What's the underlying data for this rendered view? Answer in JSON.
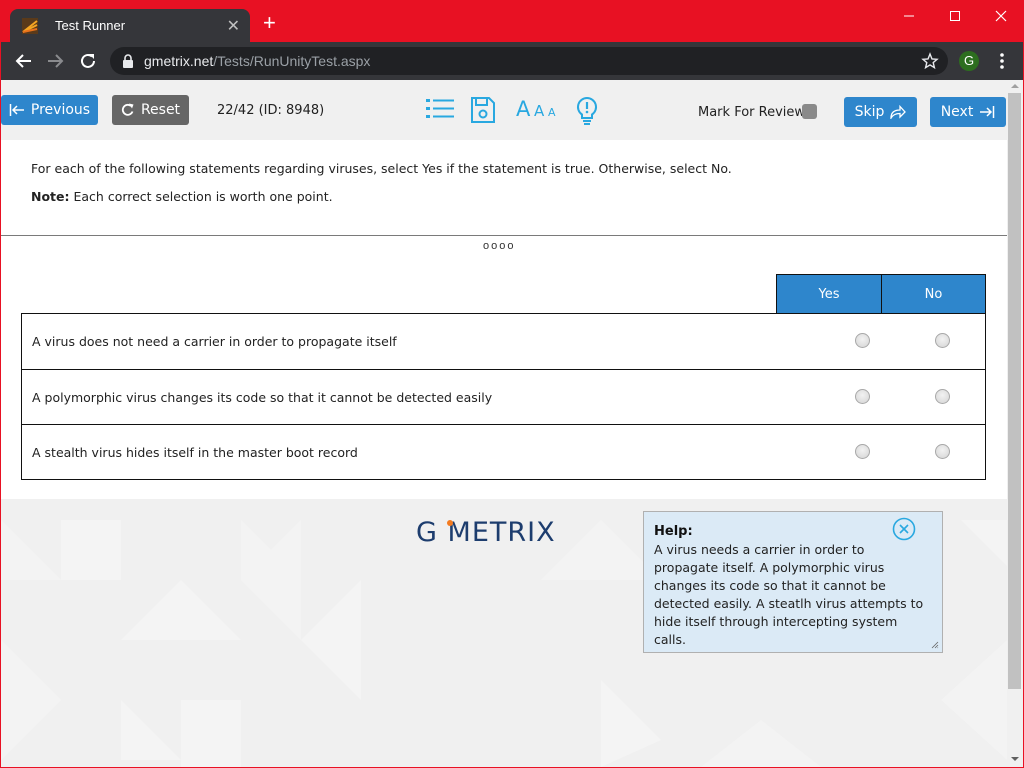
{
  "browser": {
    "tab_title": "Test Runner",
    "url_host": "gmetrix.net",
    "url_path": "/Tests/RunUnityTest.aspx",
    "profile_initial": "G",
    "colors": {
      "frame": "#e81123",
      "tab": "#35363a",
      "avatar": "#2d6e1f"
    }
  },
  "testbar": {
    "previous_label": "Previous",
    "reset_label": "Reset",
    "question_counter": "22/42 (ID: 8948)",
    "tools": [
      "list-icon",
      "save-icon",
      "font-size-icon",
      "hint-icon"
    ],
    "mark_for_review_label": "Mark For Review",
    "skip_label": "Skip",
    "next_label": "Next",
    "colors": {
      "primary": "#2e86cc",
      "reset": "#666666",
      "icon": "#29a8e0"
    }
  },
  "question": {
    "prompt": "For each of the following statements regarding viruses, select Yes if the statement is true. Otherwise, select No.",
    "note_label": "Note:",
    "note_text": " Each correct selection is worth one point.",
    "pager": "oooo",
    "columns": [
      "Yes",
      "No"
    ],
    "statements": [
      {
        "text": "A virus does not need a carrier in order to propagate itself",
        "selected": null
      },
      {
        "text": "A polymorphic virus changes its code so that it cannot be detected easily",
        "selected": null
      },
      {
        "text": "A stealth virus hides itself in the master boot record",
        "selected": null
      }
    ]
  },
  "logo": {
    "text_g": "G",
    "text_rest": "METRIX",
    "dot_color": "#f47b20"
  },
  "help": {
    "title": "Help:",
    "text": "A virus needs a carrier in order to propagate itself. A polymorphic virus changes its code so that it cannot be detected easily. A steatlh virus attempts to hide itself through intercepting system calls."
  }
}
